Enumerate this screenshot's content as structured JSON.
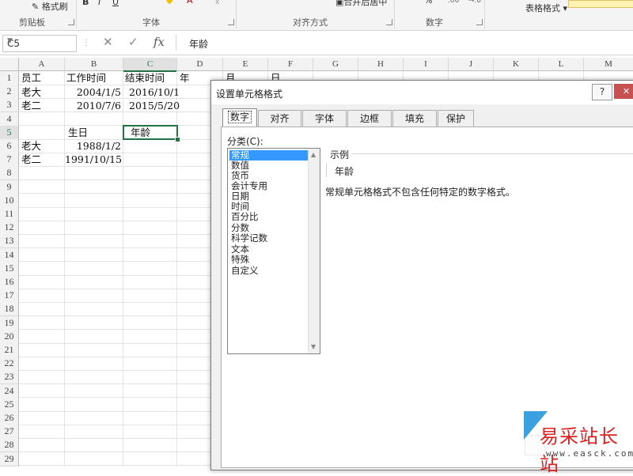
{
  "ribbon": {
    "format_painter": "格式刷",
    "clipboard_label": "剪贴板",
    "font_label": "字体",
    "alignment_label": "对齐方式",
    "merge_center": "合并后居中",
    "number_label": "数字",
    "percent": "%",
    "table_format": "表格格式"
  },
  "formula_bar": {
    "name_box": "C5",
    "fx": "fx",
    "content": "年龄"
  },
  "sheet": {
    "columns": [
      "A",
      "B",
      "C",
      "D",
      "E",
      "F",
      "G",
      "H",
      "I",
      "J",
      "K",
      "L",
      "M"
    ],
    "rows": [
      "1",
      "2",
      "3",
      "4",
      "5",
      "6",
      "7",
      "8",
      "9",
      "10",
      "11",
      "12",
      "13",
      "14",
      "15",
      "16",
      "17",
      "18",
      "19",
      "20",
      "21",
      "22",
      "23",
      "24",
      "25",
      "26",
      "27",
      "28",
      "29"
    ],
    "cells": {
      "A1": "员工",
      "B1": "工作时间",
      "C1": "结束时间",
      "D1": "年",
      "E1": "月",
      "F1": "日",
      "A2": "老大",
      "B2": "2004/1/5",
      "C2": "2016/10/1",
      "A3": "老二",
      "B3": "2010/7/6",
      "C3": "2015/5/20",
      "B5": "生日",
      "C5": "年龄",
      "A6": "老大",
      "B6": "1988/1/2",
      "A7": "老二",
      "B7": "1991/10/15"
    },
    "active_cell": "C5"
  },
  "dialog": {
    "title": "设置单元格格式",
    "help": "?",
    "close": "✕",
    "tabs": [
      "数字",
      "对齐",
      "字体",
      "边框",
      "填充",
      "保护"
    ],
    "active_tab": "数字",
    "category_label": "分类(C):",
    "categories": [
      "常规",
      "数值",
      "货币",
      "会计专用",
      "日期",
      "时间",
      "百分比",
      "分数",
      "科学记数",
      "文本",
      "特殊",
      "自定义"
    ],
    "selected_category": "常规",
    "sample_label": "示例",
    "sample_value": "年龄",
    "description": "常规单元格格式不包含任何特定的数字格式。"
  },
  "watermark": {
    "text": "易采站长站",
    "url": "www.easck.com"
  },
  "colors": {
    "excel_green": "#217346",
    "selection_blue": "#3399ff",
    "close_red": "#c75050",
    "watermark_red": "#dd2222"
  }
}
